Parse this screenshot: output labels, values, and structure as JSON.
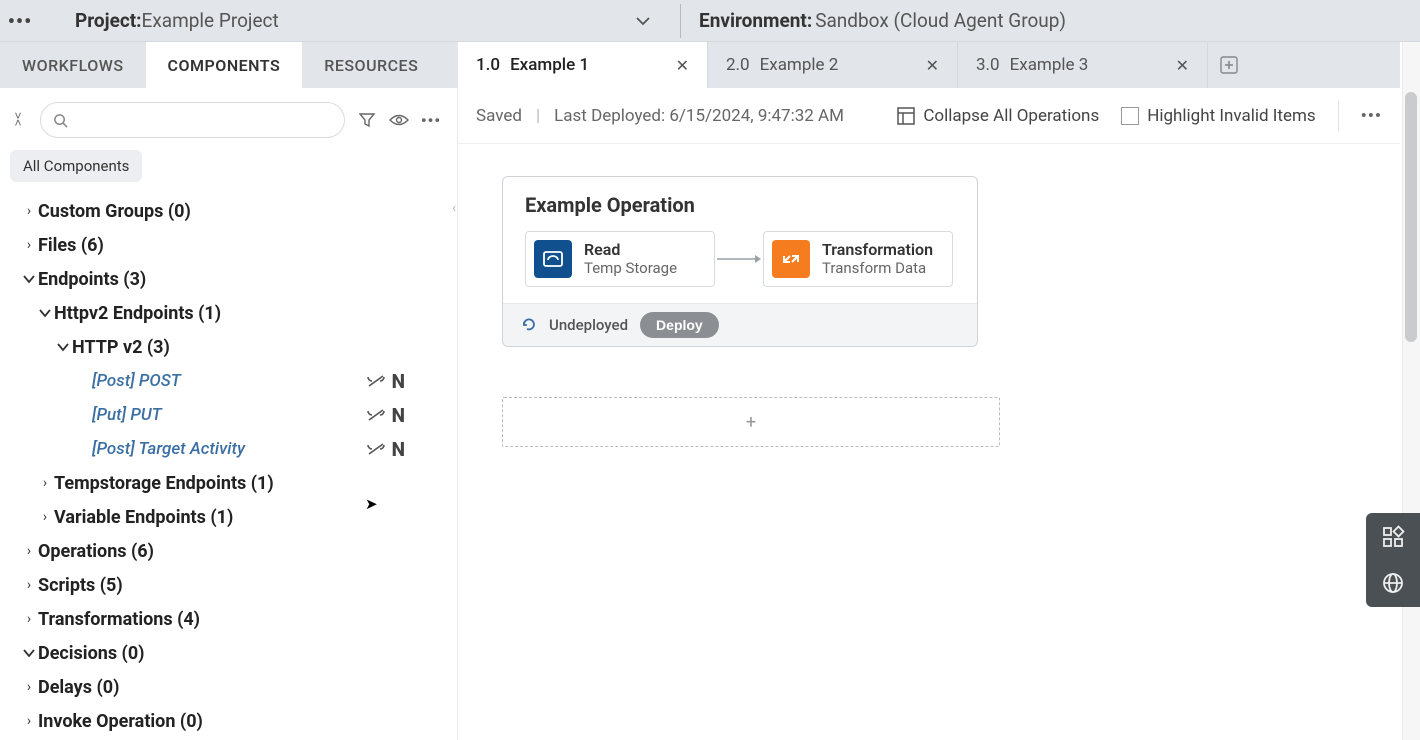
{
  "header": {
    "project_label": "Project:",
    "project_name": " Example Project",
    "env_label": "Environment:",
    "env_name": "Sandbox (Cloud Agent Group)"
  },
  "sidebar": {
    "tabs": {
      "workflows": "WORKFLOWS",
      "components": "COMPONENTS",
      "resources": "RESOURCES"
    },
    "chip": "All Components",
    "tree": {
      "custom_groups": "Custom Groups (0)",
      "files": "Files (6)",
      "endpoints": "Endpoints (3)",
      "httpv2_endpoints": "Httpv2 Endpoints (1)",
      "http_v2": "HTTP v2 (3)",
      "leaf_post": "[Post] POST",
      "leaf_put": "[Put] PUT",
      "leaf_target": "[Post] Target Activity",
      "tempstorage": "Tempstorage Endpoints (1)",
      "variable": "Variable Endpoints (1)",
      "operations": "Operations (6)",
      "scripts": "Scripts (5)",
      "transformations": "Transformations (4)",
      "decisions": "Decisions (0)",
      "delays": "Delays (0)",
      "invoke": "Invoke Operation (0)",
      "n_badge": "N"
    }
  },
  "canvas": {
    "tabs": [
      {
        "num": "1.0",
        "label": "Example 1"
      },
      {
        "num": "2.0",
        "label": "Example 2"
      },
      {
        "num": "3.0",
        "label": "Example 3"
      }
    ],
    "toolbar": {
      "saved": "Saved",
      "deployed": "Last Deployed: 6/15/2024, 9:47:32 AM",
      "collapse": "Collapse All Operations",
      "highlight": "Highlight Invalid Items"
    },
    "operation": {
      "title": "Example Operation",
      "step1_t": "Read",
      "step1_s": "Temp Storage",
      "step2_t": "Transformation",
      "step2_s": "Transform Data",
      "status": "Undeployed",
      "deploy": "Deploy"
    }
  }
}
